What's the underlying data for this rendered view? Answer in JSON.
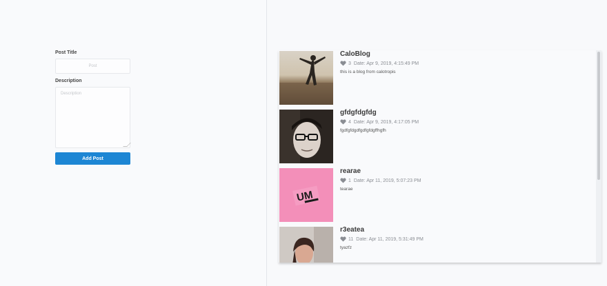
{
  "form": {
    "title_label": "Post Title",
    "title_placeholder": "Post",
    "description_label": "Description",
    "description_placeholder": "Description",
    "submit_label": "Add Post"
  },
  "posts": [
    {
      "title": "CaloBlog",
      "likes": "3",
      "date": "Date: Apr 9, 2019, 4:15:49 PM",
      "description": "this is a blog from calotropis",
      "image": "person-jumping-photo"
    },
    {
      "title": "gfdgfdgfdg",
      "likes": "4",
      "date": "Date: Apr 9, 2019, 4:17:05 PM",
      "description": "fgdfgfdgdfgdfgfdgffhgfh",
      "image": "man-with-glasses-photo"
    },
    {
      "title": "rearae",
      "likes": "1",
      "date": "Date: Apr 11, 2019, 5:07:23 PM",
      "description": "tearae",
      "image": "um-logo-pink"
    },
    {
      "title": "r3eatea",
      "likes": "11",
      "date": "Date: Apr 11, 2019, 5:31:49 PM",
      "description": "tyazfz",
      "image": "woman-portrait-photo"
    }
  ],
  "colors": {
    "primary_button": "#1d86d4",
    "page_background": "#f8f9fb"
  }
}
